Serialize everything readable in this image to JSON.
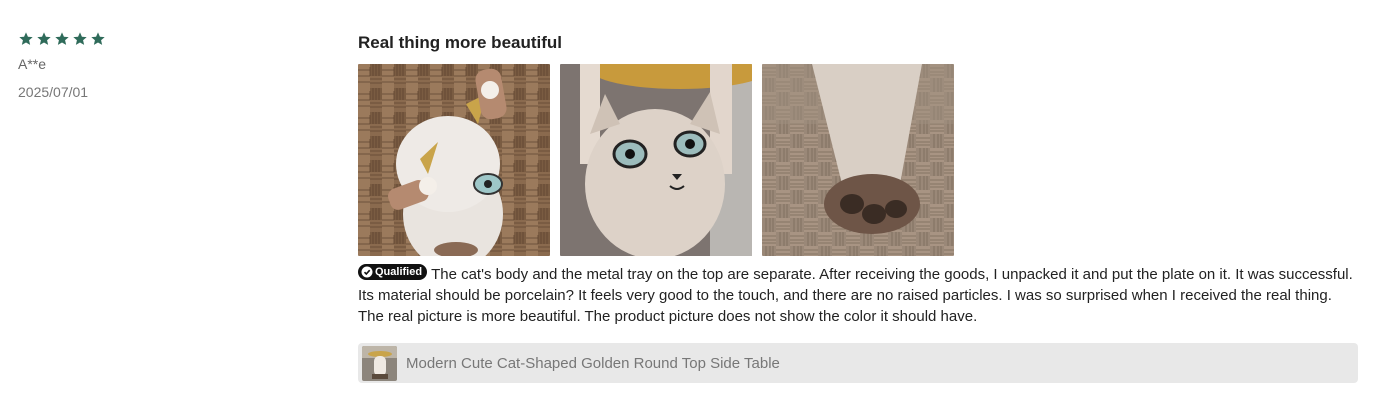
{
  "review": {
    "rating": 5,
    "rating_max": 5,
    "author": "A**e",
    "date": "2025/07/01",
    "title": "Real thing more beautiful",
    "badge_label": "Qualified",
    "text": "The cat's body and the metal tray on the top are separate. After receiving the goods, I unpacked it and put the plate on it. It was successful. Its material should be porcelain? It feels very good to the touch, and there are no raised particles. I was so surprised when I received the real thing. The real picture is more beautiful. The product picture does not show the color it should have.",
    "photos": [
      {
        "icon": "review-photo-cat-full-body"
      },
      {
        "icon": "review-photo-cat-face"
      },
      {
        "icon": "review-photo-cat-paw"
      }
    ]
  },
  "product": {
    "name": "Modern Cute Cat-Shaped Golden Round Top Side Table",
    "icon": "product-thumbnail"
  },
  "colors": {
    "star": "#2f6b5a",
    "badge_bg": "#111111",
    "product_bar_bg": "#e8e8e8"
  }
}
